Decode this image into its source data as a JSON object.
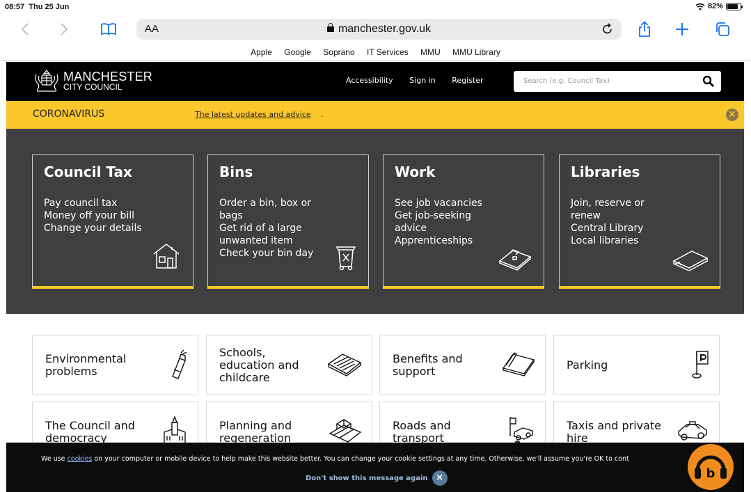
{
  "status": {
    "time": "08:57",
    "date": "Thu 25 Jun",
    "battery": "82%",
    "battery_level": 0.82
  },
  "browser": {
    "text_size_label": "AA",
    "url": "manchester.gov.uk",
    "favorites": [
      "Apple",
      "Google",
      "Soprano",
      "IT Services",
      "MMU",
      "MMU Library"
    ]
  },
  "header": {
    "logo_line1": "MANCHESTER",
    "logo_line2": "CITY COUNCIL",
    "links": [
      "Accessibility",
      "Sign in",
      "Register"
    ],
    "search_placeholder": "Search (e.g. Council Tax)"
  },
  "banner": {
    "label": "CORONAVIRUS",
    "link": "The latest updates and advice",
    "link_suffix": "."
  },
  "cards": [
    {
      "title": "Council Tax",
      "lines": [
        "Pay council tax",
        "Money off your bill",
        "Change your details"
      ],
      "icon": "house-icon"
    },
    {
      "title": "Bins",
      "lines": [
        "Order a bin, box or bags",
        "Get rid of a large unwanted item",
        "Check your bin day"
      ],
      "icon": "wheelie-bin-icon"
    },
    {
      "title": "Work",
      "lines": [
        "See job vacancies",
        "Get job-seeking advice",
        "Apprenticeships"
      ],
      "icon": "briefcase-icon"
    },
    {
      "title": "Libraries",
      "lines": [
        "Join, reserve or renew",
        "Central Library",
        "Local libraries"
      ],
      "icon": "book-icon"
    }
  ],
  "tiles": [
    {
      "label": "Environmental problems",
      "icon": "spray-can-icon"
    },
    {
      "label": "Schools, education and childcare",
      "icon": "exercise-book-icon"
    },
    {
      "label": "Benefits and support",
      "icon": "wallet-icon"
    },
    {
      "label": "Parking",
      "icon": "parking-sign-icon"
    },
    {
      "label": "The Council and democracy",
      "icon": "town-hall-icon"
    },
    {
      "label": "Planning and regeneration",
      "icon": "building-plan-icon"
    },
    {
      "label": "Roads and transport",
      "icon": "traffic-icon"
    },
    {
      "label": "Taxis and private hire",
      "icon": "taxi-icon"
    }
  ],
  "cookie": {
    "prefix": "We use ",
    "link": "cookies",
    "suffix": " on your computer or mobile device to help make this website better. You can change your cookie settings at any time. Otherwise, we'll assume you're OK to cont",
    "dismiss": "Don't show this message again",
    "dismiss_icon": "close-icon"
  },
  "colors": {
    "brand_black": "#000000",
    "accent_yellow": "#fcc72c",
    "hero_grey": "#3f3f3f",
    "assist_orange": "#f08c1e"
  }
}
